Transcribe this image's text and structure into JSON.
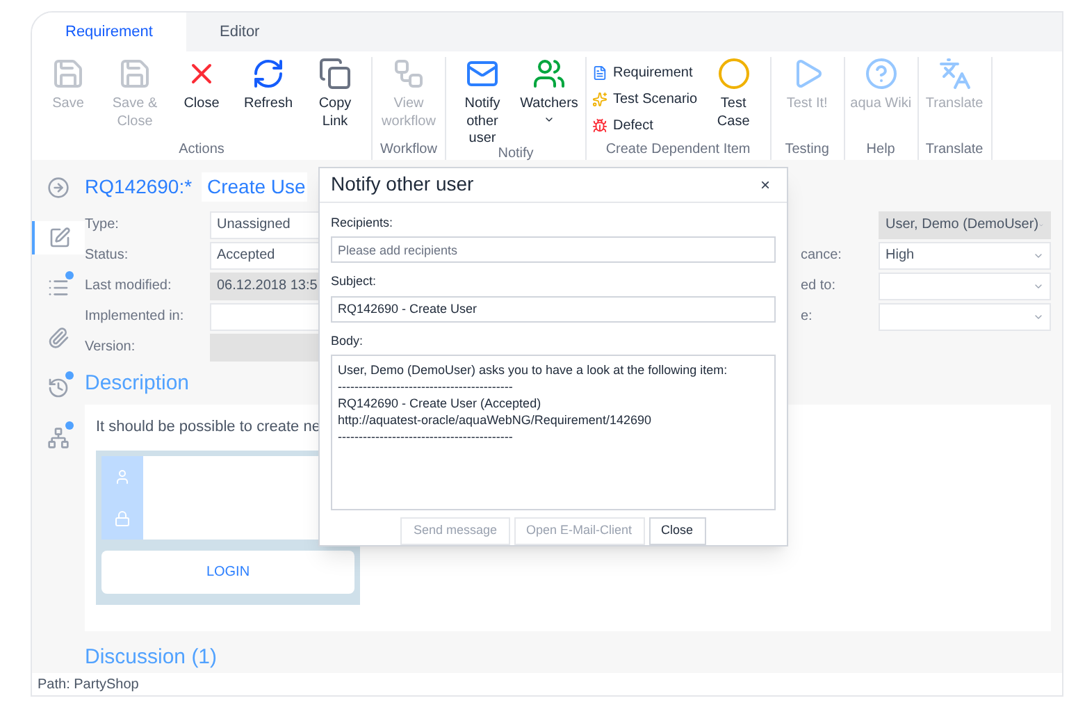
{
  "tabs": [
    {
      "label": "Requirement",
      "selected": true
    },
    {
      "label": "Editor",
      "selected": false
    }
  ],
  "ribbon": {
    "groups": [
      {
        "label": "Actions",
        "items": [
          {
            "kind": "large",
            "label": "Save",
            "disabled": true
          },
          {
            "kind": "large",
            "label": "Save & Close",
            "disabled": true
          },
          {
            "kind": "large",
            "label": "Close",
            "disabled": false
          },
          {
            "kind": "large",
            "label": "Refresh",
            "disabled": false
          },
          {
            "kind": "large",
            "label": "Copy Link",
            "disabled": false
          }
        ]
      },
      {
        "label": "Workflow",
        "items": [
          {
            "kind": "large",
            "label": "View workflow",
            "disabled": true
          }
        ]
      },
      {
        "label": "Notify",
        "items": [
          {
            "kind": "large",
            "label": "Notify other user",
            "disabled": false
          },
          {
            "kind": "large",
            "label": "Watchers",
            "disabled": false
          }
        ]
      },
      {
        "label": "Create Dependent Item",
        "items": [
          {
            "kind": "small",
            "label": "Requirement",
            "disabled": false
          },
          {
            "kind": "small",
            "label": "Test Scenario",
            "disabled": false
          },
          {
            "kind": "small",
            "label": "Defect",
            "disabled": false
          },
          {
            "kind": "large",
            "label": "Test Case",
            "disabled": false
          }
        ]
      },
      {
        "label": "Testing",
        "items": [
          {
            "kind": "large",
            "label": "Test It!",
            "disabled": true
          }
        ]
      },
      {
        "label": "Help",
        "items": [
          {
            "kind": "large",
            "label": "aqua Wiki",
            "disabled": true
          }
        ]
      },
      {
        "label": "Translate",
        "items": [
          {
            "kind": "large",
            "label": "Translate",
            "disabled": true
          }
        ]
      }
    ]
  },
  "sidebar": {
    "items": [
      {
        "selected": false,
        "badge": false
      },
      {
        "selected": true,
        "badge": false
      },
      {
        "selected": false,
        "badge": true
      },
      {
        "selected": false,
        "badge": false
      },
      {
        "selected": false,
        "badge": true
      },
      {
        "selected": false,
        "badge": true
      }
    ]
  },
  "item": {
    "id": "RQ142690:*",
    "title": "Create Use"
  },
  "fields_left": [
    {
      "label": "Type:",
      "value": "Unassigned",
      "disabled": false
    },
    {
      "label": "Status:",
      "value": "Accepted",
      "disabled": false
    },
    {
      "label": "Last modified:",
      "value": "06.12.2018 13:5",
      "disabled": true
    },
    {
      "label": "Implemented in:",
      "disabled": false
    },
    {
      "label": "Version:",
      "disabled": true
    }
  ],
  "fields_right": [
    {
      "value": "User, Demo (DemoUser)",
      "disabled": true
    },
    {
      "label": "cance:",
      "value": "High",
      "disabled": false
    },
    {
      "label": "ed to:",
      "disabled": false
    },
    {
      "label": "e:",
      "disabled": false
    }
  ],
  "description": {
    "heading": "Description",
    "text": "It should be possible to create ne",
    "login_button": "LOGIN"
  },
  "discussion": {
    "heading": "Discussion (1)"
  },
  "status_bar": "Path: PartyShop",
  "dialog": {
    "title": "Notify other user",
    "close": "×",
    "recipients": {
      "label": "Recipients:",
      "placeholder": "Please add recipients"
    },
    "subject": {
      "label": "Subject:",
      "value": "RQ142690 - Create User"
    },
    "body": {
      "label": "Body:",
      "lines": [
        "User, Demo (DemoUser) asks you to have a look at the following item:",
        "------------------------------------------",
        "RQ142690 - Create User (Accepted)",
        "http://aquatest-oracle/aquaWebNG/Requirement/142690",
        "------------------------------------------"
      ]
    },
    "buttons": [
      {
        "label": "Send message",
        "disabled": true
      },
      {
        "label": "Open E-Mail-Client",
        "disabled": true
      },
      {
        "label": "Close",
        "disabled": false
      }
    ]
  }
}
